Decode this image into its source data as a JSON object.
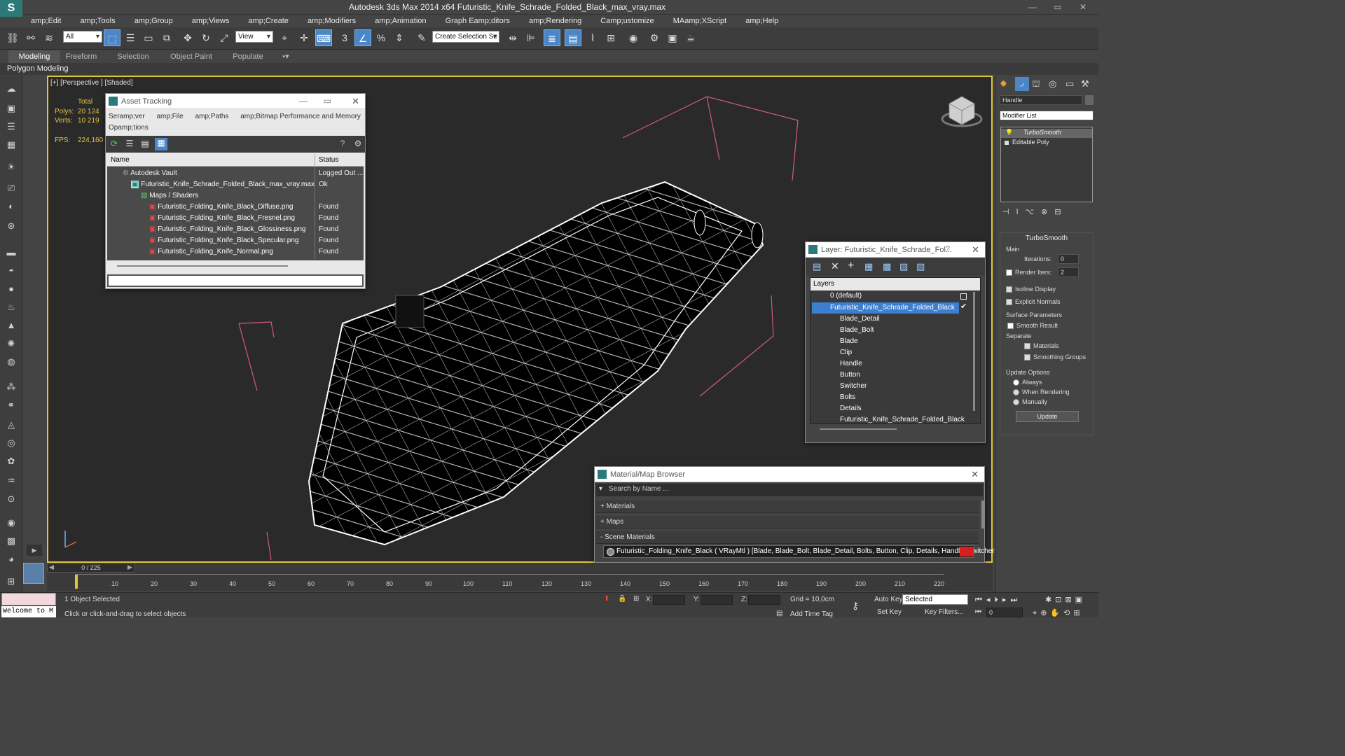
{
  "app": {
    "logo": "S",
    "title": "Autodesk 3ds Max  2014 x64     Futuristic_Knife_Schrade_Folded_Black_max_vray.max"
  },
  "window_controls": {
    "min": "—",
    "max": "▭",
    "close": "✕"
  },
  "menu": [
    "amp;Edit",
    "amp;Tools",
    "amp;Group",
    "amp;Views",
    "amp;Create",
    "amp;Modifiers",
    "amp;Animation",
    "Graph Eamp;ditors",
    "amp;Rendering",
    "Camp;ustomize",
    "MAamp;XScript",
    "amp;Help"
  ],
  "toolbar": {
    "filter_value": "All",
    "view_value": "View",
    "selection_set_value": "Create Selection Se"
  },
  "ribbon": {
    "tabs": [
      "Modeling",
      "Freeform",
      "Selection",
      "Object Paint",
      "Populate"
    ],
    "active": "Modeling",
    "sub": "Polygon Modeling"
  },
  "viewport": {
    "label": "[+] [Perspective ] [Shaded]",
    "stats": {
      "total_header": "Total",
      "polys_label": "Polys:",
      "polys_value": "20 124",
      "verts_label": "Verts:",
      "verts_value": "10 219",
      "fps_label": "FPS:",
      "fps_value": "224,160"
    }
  },
  "asset_tracking": {
    "title": "Asset Tracking",
    "menu": [
      "Seramp;ver",
      "amp;File",
      "amp;Paths",
      "amp;Bitmap Performance and Memory"
    ],
    "menu2": "Opamp;tions",
    "columns": [
      "Name",
      "Status"
    ],
    "rows": [
      {
        "name": "Autodesk Vault",
        "status": "Logged Out ..."
      },
      {
        "name": "Futuristic_Knife_Schrade_Folded_Black_max_vray.max",
        "status": "Ok"
      },
      {
        "name": "Maps / Shaders",
        "status": ""
      },
      {
        "name": "Futuristic_Folding_Knife_Black_Diffuse.png",
        "status": "Found"
      },
      {
        "name": "Futuristic_Folding_Knife_Black_Fresnel.png",
        "status": "Found"
      },
      {
        "name": "Futuristic_Folding_Knife_Black_Glossiness.png",
        "status": "Found"
      },
      {
        "name": "Futuristic_Folding_Knife_Black_Specular.png",
        "status": "Found"
      },
      {
        "name": "Futuristic_Folding_Knife_Normal.png",
        "status": "Found"
      }
    ]
  },
  "layer_dialog": {
    "title": "Layer: Futuristic_Knife_Schrade_Fol...",
    "help": "?",
    "header": "Layers",
    "layers": [
      "0 (default)",
      "Futuristic_Knife_Schrade_Folded_Black",
      "Blade_Detail",
      "Blade_Bolt",
      "Blade",
      "Clip",
      "Handle",
      "Button",
      "Switcher",
      "Bolts",
      "Details",
      "Futuristic_Knife_Schrade_Folded_Black"
    ]
  },
  "material_browser": {
    "title": "Material/Map Browser",
    "search_placeholder": "Search by Name ...",
    "sections": [
      "+ Materials",
      "+ Maps",
      "- Scene Materials"
    ],
    "scene_material": "Futuristic_Folding_Knife_Black ( VRayMtl ) [Blade, Blade_Bolt, Blade_Detail, Bolts, Button, Clip, Details, Handle, Switcher]"
  },
  "command_panel": {
    "object_name": "Handle",
    "modifier_list": "Modifier List",
    "stack": [
      "TurboSmooth",
      "Editable Poly"
    ],
    "rollout_title": "TurboSmooth",
    "main_label": "Main",
    "iterations_label": "Iterations:",
    "iterations_value": "0",
    "render_iters_label": "Render Iters:",
    "render_iters_value": "2",
    "isoline": "Isoline Display",
    "explicit": "Explicit Normals",
    "surface_params": "Surface Parameters",
    "smooth_result": "Smooth Result",
    "separate": "Separate",
    "materials": "Materials",
    "smoothing_groups": "Smoothing Groups",
    "update_options": "Update Options",
    "always": "Always",
    "when_rendering": "When Rendering",
    "manually": "Manually",
    "update_btn": "Update"
  },
  "timeline": {
    "frame_counter": "0 / 225",
    "ticks": [
      "10",
      "20",
      "30",
      "40",
      "50",
      "60",
      "70",
      "80",
      "90",
      "100",
      "110",
      "120",
      "130",
      "140",
      "150",
      "160",
      "170",
      "180",
      "190",
      "200",
      "210",
      "220"
    ]
  },
  "status": {
    "maxscript": "Welcome to M",
    "selected": "1 Object Selected",
    "prompt": "Click or click-and-drag to select objects",
    "x_label": "X:",
    "y_label": "Y:",
    "z_label": "Z:",
    "grid": "Grid = 10,0cm",
    "add_time_tag": "Add Time Tag",
    "auto_key": "Auto Key",
    "set_key": "Set Key",
    "selected_dd": "Selected",
    "key_filters": "Key Filters...",
    "frame_field": "0"
  },
  "colors": {
    "accent": "#4b86c6",
    "viewport_border": "#e0c43a",
    "selected_layer": "#3c7fd1"
  }
}
